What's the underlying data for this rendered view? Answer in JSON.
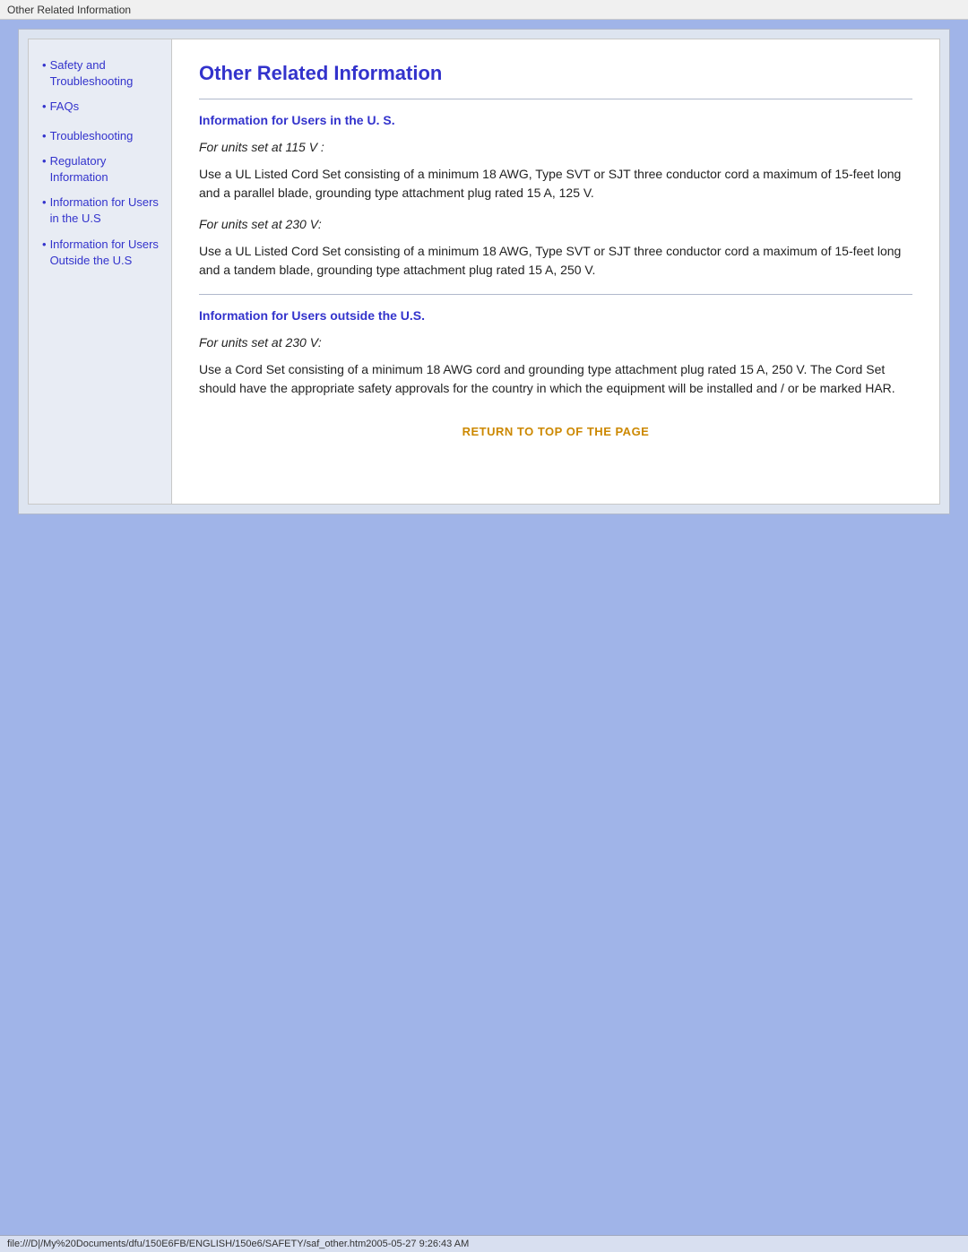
{
  "titlebar": {
    "text": "Other Related Information"
  },
  "sidebar": {
    "items": [
      {
        "id": "safety",
        "label": "Safety and Troubleshooting",
        "href": "#"
      },
      {
        "id": "faqs",
        "label": "FAQs",
        "href": "#"
      },
      {
        "id": "troubleshooting",
        "label": "Troubleshooting",
        "href": "#"
      },
      {
        "id": "regulatory",
        "label": "Regulatory Information",
        "href": "#"
      },
      {
        "id": "info-us",
        "label": "Information for Users in the U.S",
        "href": "#"
      },
      {
        "id": "info-outside",
        "label": "Information for Users Outside the U.S",
        "href": "#"
      }
    ]
  },
  "main": {
    "title": "Other Related Information",
    "section1": {
      "heading": "Information for Users in the U. S.",
      "para1_italic": "For units set at 115 V :",
      "para1_body": "Use a UL Listed Cord Set consisting of a minimum 18 AWG, Type SVT or SJT three conductor cord a maximum of 15-feet long and a parallel blade, grounding type attachment plug rated 15 A, 125 V.",
      "para2_italic": "For units set at 230 V:",
      "para2_body": "Use a UL Listed Cord Set consisting of a minimum 18 AWG, Type SVT or SJT three conductor cord a maximum of 15-feet long and a tandem blade, grounding type attachment plug rated 15 A, 250 V."
    },
    "section2": {
      "heading": "Information for Users outside the U.S.",
      "para1_italic": "For units set at 230 V:",
      "para1_body": "Use a Cord Set consisting of a minimum 18 AWG cord and grounding type attachment plug rated 15 A, 250 V. The Cord Set should have the appropriate safety approvals for the country in which the equipment will be installed and / or be marked HAR."
    },
    "return_link": "RETURN TO TOP OF THE PAGE"
  },
  "statusbar": {
    "text": "file:///D|/My%20Documents/dfu/150E6FB/ENGLISH/150e6/SAFETY/saf_other.htm2005-05-27  9:26:43 AM"
  }
}
